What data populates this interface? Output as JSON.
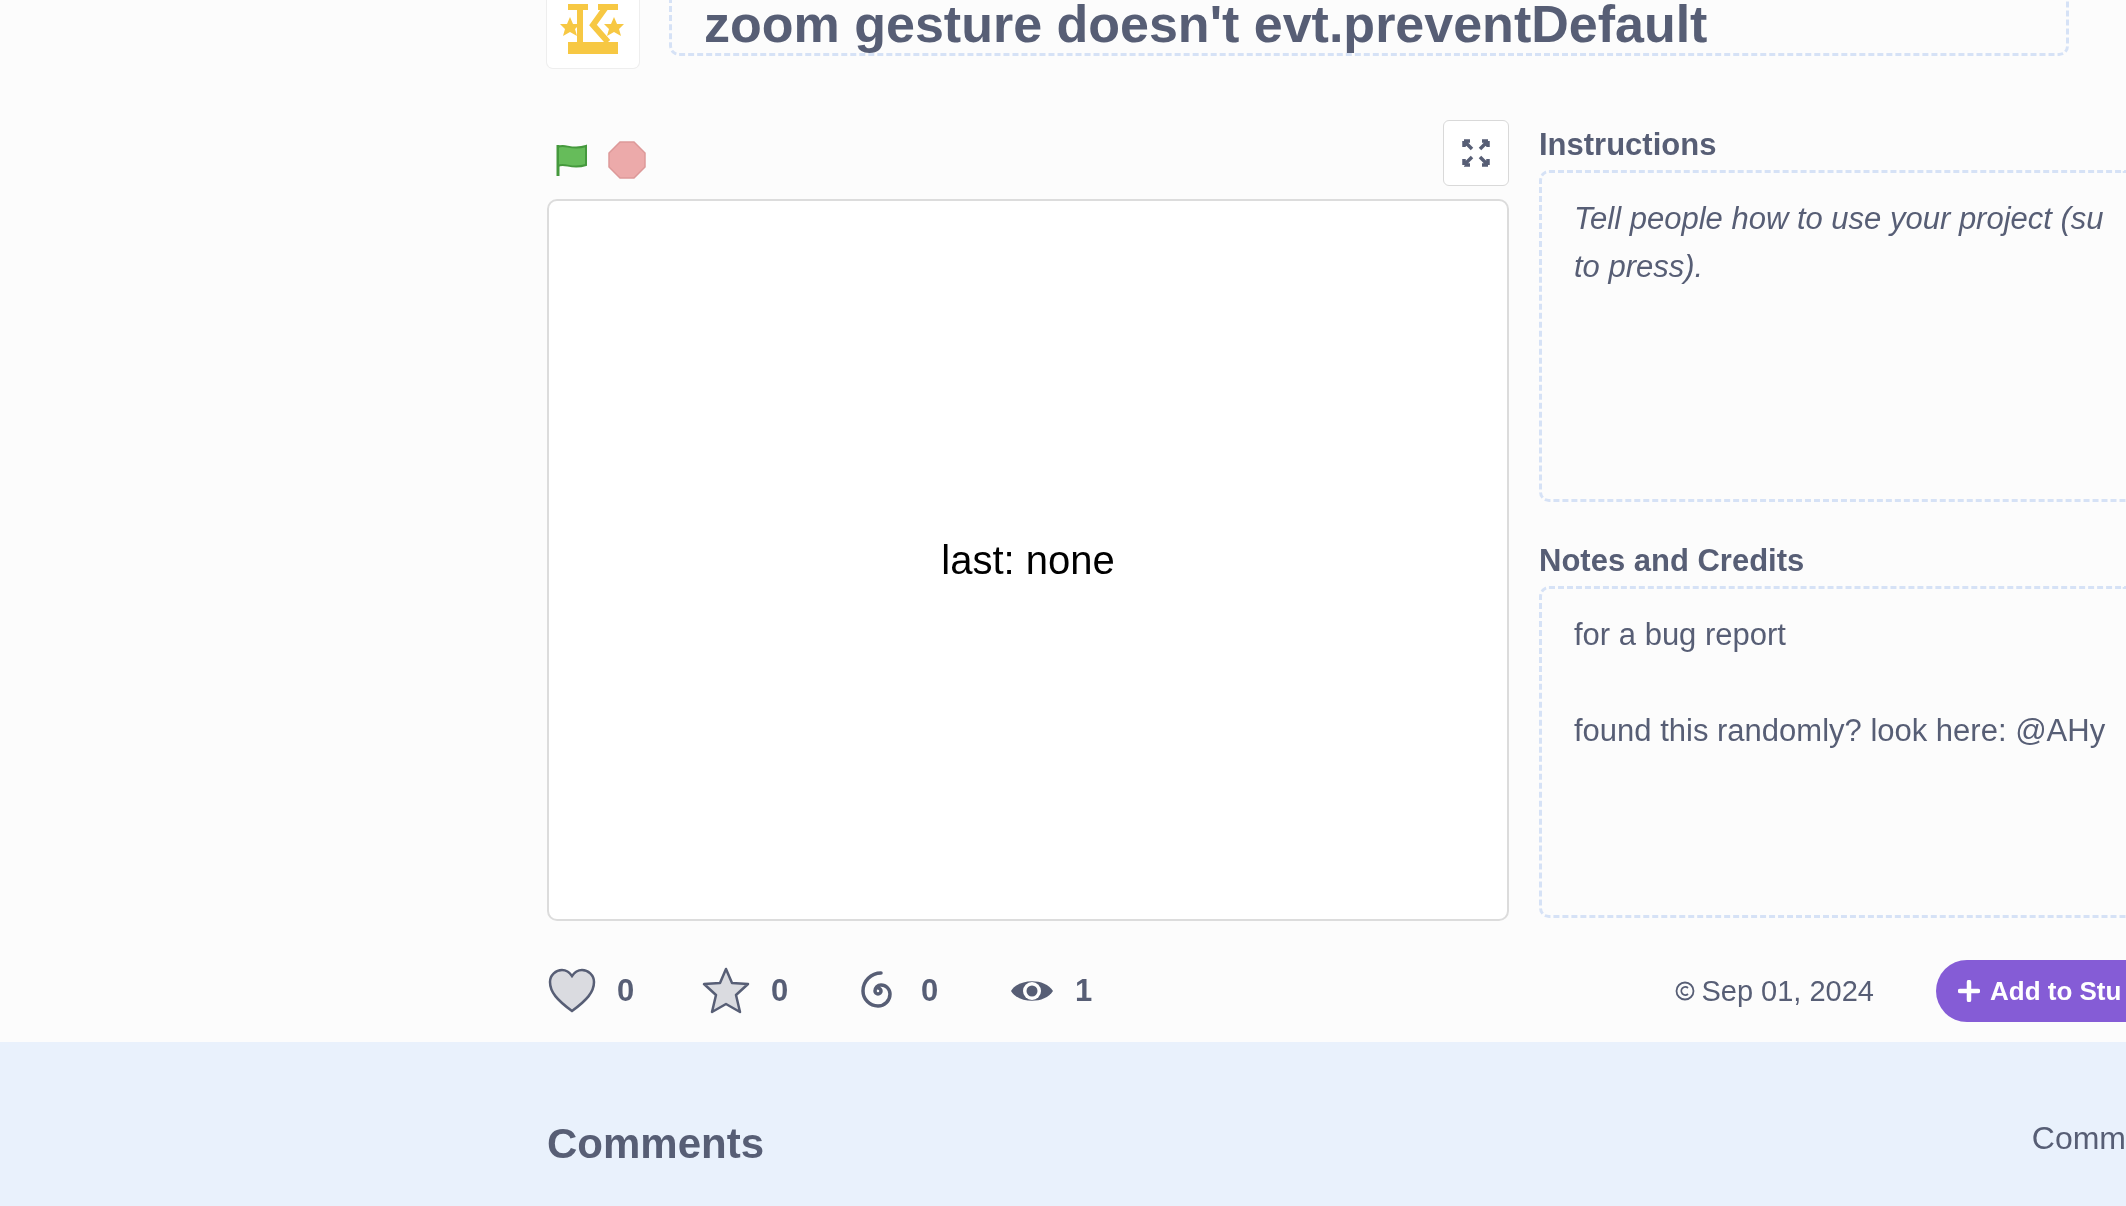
{
  "project": {
    "title": "zoom gesture doesn't evt.preventDefault"
  },
  "player": {
    "stage_text": "last: none"
  },
  "instructions": {
    "heading": "Instructions",
    "kind": "placeholder",
    "lines": [
      "Tell people how to use your project (su",
      "to press)."
    ]
  },
  "notes": {
    "heading": "Notes and Credits",
    "kind": "text",
    "lines": [
      "for a bug report",
      "found this randomly? look here: @AHy"
    ]
  },
  "stats": [
    {
      "kind": "love",
      "count": "0"
    },
    {
      "kind": "favorite",
      "count": "0"
    },
    {
      "kind": "remix",
      "count": "0"
    },
    {
      "kind": "views",
      "count": "1"
    }
  ],
  "shared_date": "Sep 01, 2024",
  "add_to_studio": "Add to Stu",
  "comments": {
    "heading": "Comments",
    "side_text": "Comm"
  }
}
